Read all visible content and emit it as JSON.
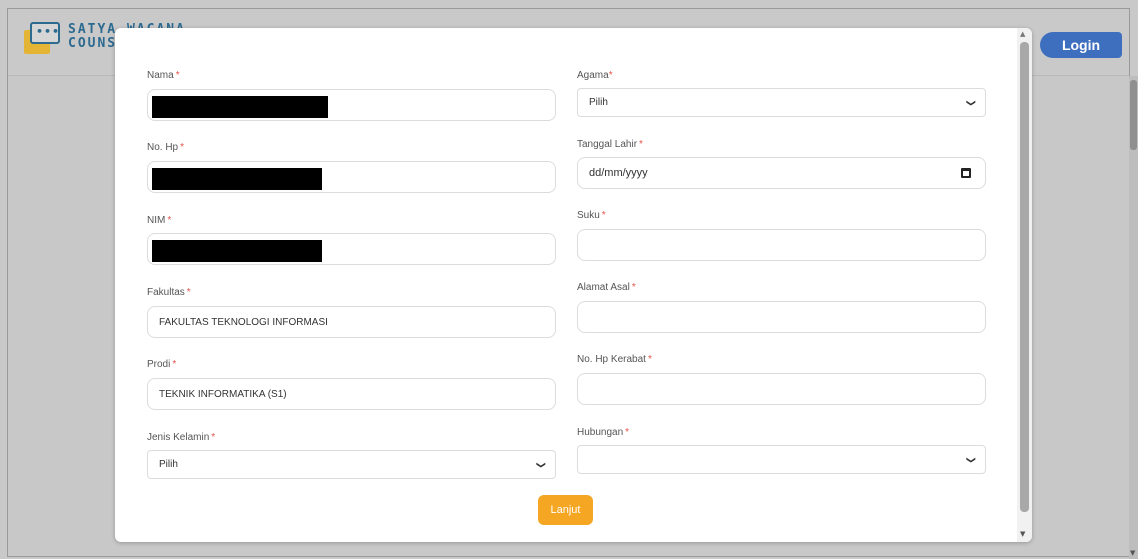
{
  "header": {
    "logo_line1": "SATYA WACANA",
    "logo_line2": "COUNSELING",
    "login_label": "Login"
  },
  "form": {
    "nama_label": "Nama",
    "nohp_label": "No. Hp",
    "nim_label": "NIM",
    "fakultas_label": "Fakultas",
    "fakultas_value": "FAKULTAS TEKNOLOGI INFORMASI",
    "prodi_label": "Prodi",
    "prodi_value": "TEKNIK INFORMATIKA (S1)",
    "jk_label": "Jenis Kelamin",
    "jk_value": "Pilih",
    "agama_label": "Agama",
    "agama_value": "Pilih",
    "tgl_label": "Tanggal Lahir",
    "tgl_placeholder": "dd/mm/yyyy",
    "suku_label": "Suku",
    "alamat_label": "Alamat Asal",
    "hpkerabat_label": "No. Hp Kerabat",
    "hubungan_label": "Hubungan",
    "hubungan_value": "",
    "required_mark": "*",
    "submit_label": "Lanjut"
  },
  "icons": {
    "chevron": "chevron-down-icon",
    "calendar": "calendar-icon"
  }
}
